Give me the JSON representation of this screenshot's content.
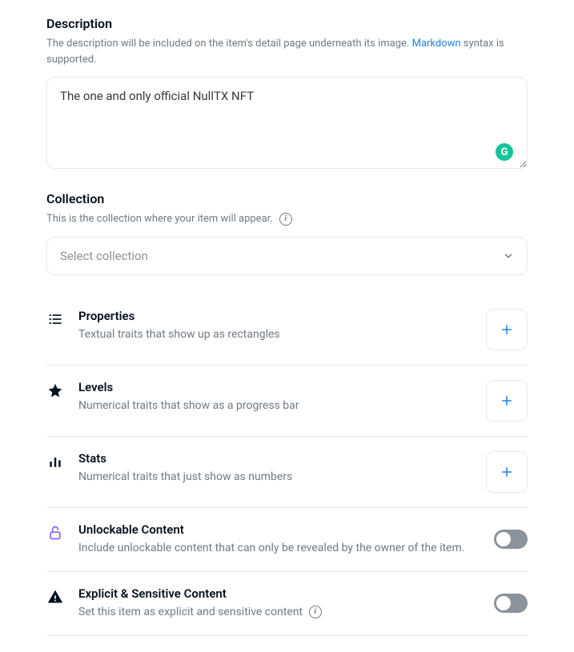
{
  "description": {
    "title": "Description",
    "help_prefix": "The description will be included on the item's detail page underneath its image. ",
    "help_link": "Markdown",
    "help_suffix": " syntax is supported.",
    "value": "The one and only official NullTX NFT"
  },
  "collection": {
    "title": "Collection",
    "help": "This is the collection where your item will appear.",
    "placeholder": "Select collection"
  },
  "traits": {
    "properties": {
      "title": "Properties",
      "desc": "Textual traits that show up as rectangles"
    },
    "levels": {
      "title": "Levels",
      "desc": "Numerical traits that show as a progress bar"
    },
    "stats": {
      "title": "Stats",
      "desc": "Numerical traits that just show as numbers"
    },
    "unlockable": {
      "title": "Unlockable Content",
      "desc": "Include unlockable content that can only be revealed by the owner of the item."
    },
    "explicit": {
      "title": "Explicit & Sensitive Content",
      "desc": "Set this item as explicit and sensitive content "
    }
  },
  "grammarly": "G",
  "info_i": "i"
}
